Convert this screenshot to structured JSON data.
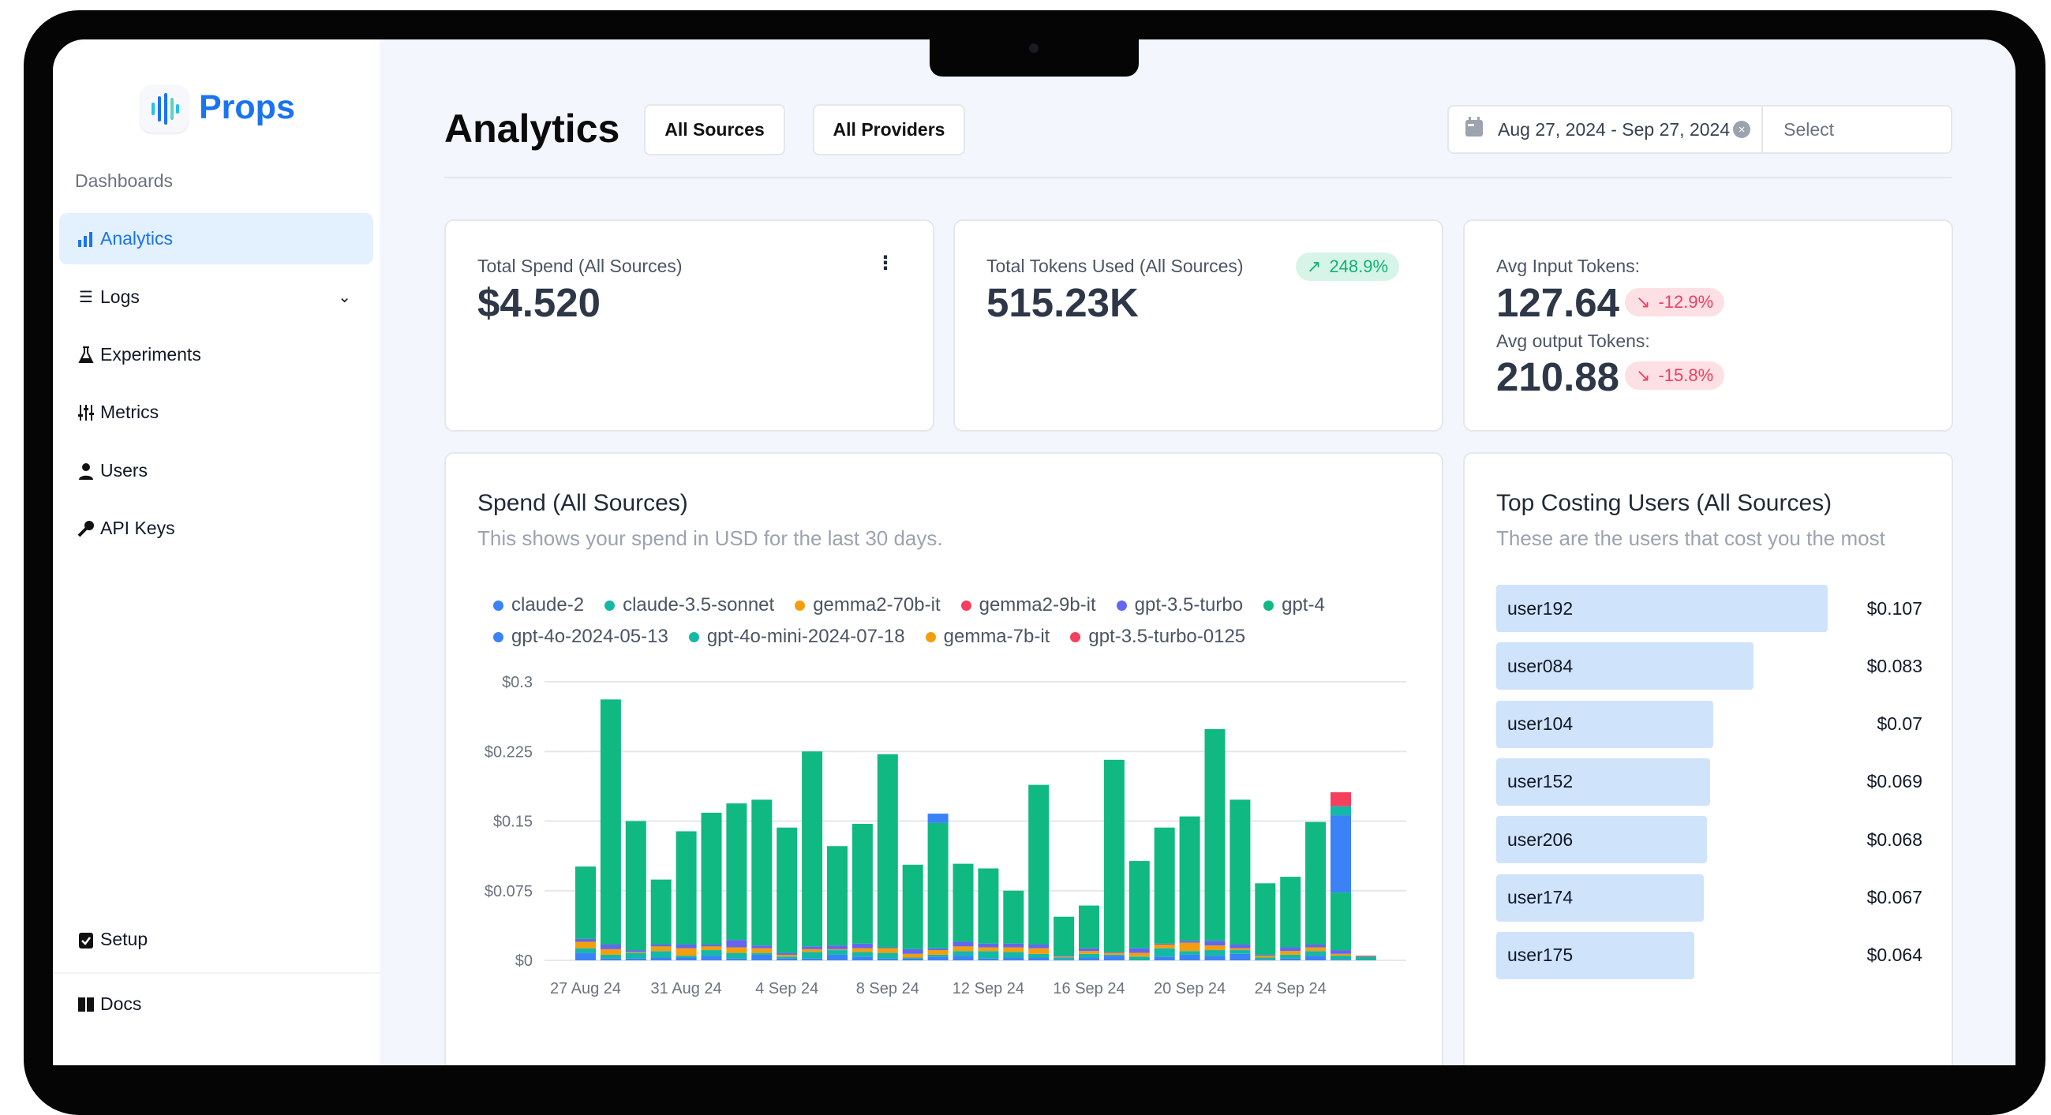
{
  "brand": {
    "name": "Props",
    "color": "#1a73f0"
  },
  "sidebar": {
    "section": "Dashboards",
    "items": [
      {
        "label": "Analytics",
        "icon": "bar-chart-icon",
        "active": true
      },
      {
        "label": "Logs",
        "icon": "list-icon",
        "expandable": true
      },
      {
        "label": "Experiments",
        "icon": "flask-icon"
      },
      {
        "label": "Metrics",
        "icon": "sliders-icon"
      },
      {
        "label": "Users",
        "icon": "user-icon"
      },
      {
        "label": "API Keys",
        "icon": "key-icon"
      }
    ],
    "bottom": [
      {
        "label": "Setup",
        "icon": "clipboard-check-icon"
      },
      {
        "label": "Docs",
        "icon": "book-icon"
      }
    ]
  },
  "header": {
    "title": "Analytics",
    "filters": [
      "All Sources",
      "All Providers"
    ],
    "date_range": "Aug 27, 2024 - Sep 27, 2024",
    "select_placeholder": "Select"
  },
  "stats": {
    "total_spend": {
      "label": "Total Spend (All Sources)",
      "value": "$4.520"
    },
    "total_tokens": {
      "label": "Total Tokens Used (All Sources)",
      "value": "515.23K",
      "change": "248.9%",
      "trend": "up"
    },
    "avg_input": {
      "label": "Avg Input Tokens:",
      "value": "127.64",
      "change": "-12.9%",
      "trend": "down"
    },
    "avg_output": {
      "label": "Avg output Tokens:",
      "value": "210.88",
      "change": "-15.8%",
      "trend": "down"
    }
  },
  "spend_card": {
    "title": "Spend (All Sources)",
    "subtitle": "This shows your spend in USD for the last 30 days."
  },
  "chart_data": {
    "type": "bar",
    "stacked": true,
    "ylim": [
      0,
      0.3
    ],
    "grid": true,
    "legend": "top",
    "yticks": [
      "$0",
      "$0.075",
      "$0.15",
      "$0.225",
      "$0.3"
    ],
    "ytick_values": [
      0,
      0.075,
      0.15,
      0.225,
      0.3
    ],
    "categories": [
      "27 Aug 24",
      "28 Aug 24",
      "29 Aug 24",
      "30 Aug 24",
      "31 Aug 24",
      "1 Sep 24",
      "2 Sep 24",
      "3 Sep 24",
      "4 Sep 24",
      "5 Sep 24",
      "6 Sep 24",
      "7 Sep 24",
      "8 Sep 24",
      "9 Sep 24",
      "10 Sep 24",
      "11 Sep 24",
      "12 Sep 24",
      "13 Sep 24",
      "14 Sep 24",
      "15 Sep 24",
      "16 Sep 24",
      "17 Sep 24",
      "18 Sep 24",
      "19 Sep 24",
      "20 Sep 24",
      "21 Sep 24",
      "22 Sep 24",
      "23 Sep 24",
      "24 Sep 24",
      "25 Sep 24",
      "26 Sep 24",
      "27 Sep 24"
    ],
    "xtick_labels": [
      "27 Aug 24",
      "31 Aug 24",
      "4 Sep 24",
      "8 Sep 24",
      "12 Sep 24",
      "16 Sep 24",
      "20 Sep 24",
      "24 Sep 24"
    ],
    "series": [
      {
        "name": "claude-2",
        "color": "#3b82f6",
        "values": [
          0.008,
          0.002,
          0.002,
          0.003,
          0.003,
          0.005,
          0.002,
          0.006,
          0.002,
          0.002,
          0.006,
          0.004,
          0.002,
          0.002,
          0.004,
          0.005,
          0.002,
          0.003,
          0.003,
          0.001,
          0.003,
          0.005,
          0,
          0.004,
          0.006,
          0.005,
          0.007,
          0.001,
          0.002,
          0.005,
          0.001,
          0
        ]
      },
      {
        "name": "claude-3.5-sonnet",
        "color": "#14b8a6",
        "values": [
          0.005,
          0.004,
          0.006,
          0.007,
          0.002,
          0.006,
          0.006,
          0.002,
          0.002,
          0.007,
          0.005,
          0.005,
          0.006,
          0.001,
          0.002,
          0.005,
          0.008,
          0.006,
          0.004,
          0.002,
          0.004,
          0.001,
          0.004,
          0.009,
          0.004,
          0.006,
          0.004,
          0.002,
          0.004,
          0.005,
          0.004,
          0.004
        ]
      },
      {
        "name": "gemma2-70b-it",
        "color": "#f59e0b",
        "values": [
          0.007,
          0.006,
          0.001,
          0.005,
          0.008,
          0.004,
          0.006,
          0.005,
          0.002,
          0.003,
          0.001,
          0.004,
          0.005,
          0.004,
          0.005,
          0.005,
          0.004,
          0.005,
          0.006,
          0.001,
          0.003,
          0.002,
          0.004,
          0.004,
          0.009,
          0.005,
          0.002,
          0.002,
          0.004,
          0.004,
          0.002,
          0
        ]
      },
      {
        "name": "gemma2-9b-it",
        "color": "#f43f5e",
        "values": [
          0,
          0,
          0,
          0,
          0,
          0,
          0,
          0,
          0,
          0,
          0,
          0,
          0,
          0,
          0,
          0,
          0,
          0,
          0,
          0,
          0,
          0,
          0,
          0,
          0,
          0,
          0,
          0,
          0,
          0,
          0,
          0
        ]
      },
      {
        "name": "gpt-3.5-turbo",
        "color": "#6366f1",
        "values": [
          0.003,
          0.005,
          0.002,
          0.002,
          0.004,
          0.002,
          0.008,
          0.003,
          0.002,
          0.003,
          0.004,
          0.005,
          0.001,
          0.005,
          0.002,
          0.005,
          0.004,
          0.004,
          0.004,
          0.001,
          0.003,
          0.001,
          0.005,
          0.001,
          0.002,
          0.005,
          0.004,
          0.001,
          0.004,
          0.003,
          0.004,
          0
        ]
      },
      {
        "name": "gpt-4",
        "color": "#10b981",
        "values": [
          0.078,
          0.264,
          0.139,
          0.07,
          0.122,
          0.142,
          0.147,
          0.157,
          0.135,
          0.21,
          0.107,
          0.129,
          0.208,
          0.091,
          0.135,
          0.084,
          0.081,
          0.057,
          0.172,
          0.042,
          0.046,
          0.207,
          0.094,
          0.125,
          0.134,
          0.228,
          0.156,
          0.077,
          0.076,
          0.132,
          0.062,
          0
        ]
      },
      {
        "name": "gpt-4o-2024-05-13",
        "color": "#3b82f6",
        "values": [
          0,
          0,
          0,
          0,
          0,
          0,
          0,
          0,
          0,
          0,
          0,
          0,
          0,
          0,
          0.01,
          0,
          0,
          0,
          0,
          0,
          0,
          0,
          0,
          0,
          0,
          0,
          0,
          0,
          0,
          0,
          0.083,
          0
        ]
      },
      {
        "name": "gpt-4o-mini-2024-07-18",
        "color": "#14b8a6",
        "values": [
          0,
          0,
          0,
          0,
          0,
          0,
          0,
          0,
          0,
          0,
          0,
          0,
          0,
          0,
          0,
          0,
          0,
          0,
          0,
          0,
          0,
          0,
          0,
          0,
          0,
          0,
          0,
          0,
          0,
          0,
          0.01,
          0
        ]
      },
      {
        "name": "gemma-7b-it",
        "color": "#f59e0b",
        "values": [
          0,
          0,
          0,
          0,
          0,
          0,
          0,
          0,
          0,
          0,
          0,
          0,
          0,
          0,
          0,
          0,
          0,
          0,
          0,
          0,
          0,
          0,
          0,
          0,
          0,
          0,
          0,
          0,
          0,
          0,
          0,
          0
        ]
      },
      {
        "name": "gpt-3.5-turbo-0125",
        "color": "#f43f5e",
        "values": [
          0,
          0,
          0,
          0,
          0,
          0,
          0,
          0,
          0,
          0,
          0,
          0,
          0,
          0,
          0,
          0,
          0,
          0,
          0,
          0,
          0,
          0,
          0,
          0,
          0,
          0,
          0,
          0,
          0,
          0,
          0.015,
          0.001
        ]
      }
    ]
  },
  "top_users": {
    "title": "Top Costing Users (All Sources)",
    "subtitle": "These are the users that cost you the most",
    "users": [
      {
        "name": "user192",
        "cost": "$0.107",
        "value": 0.107
      },
      {
        "name": "user084",
        "cost": "$0.083",
        "value": 0.083
      },
      {
        "name": "user104",
        "cost": "$0.07",
        "value": 0.07
      },
      {
        "name": "user152",
        "cost": "$0.069",
        "value": 0.069
      },
      {
        "name": "user206",
        "cost": "$0.068",
        "value": 0.068
      },
      {
        "name": "user174",
        "cost": "$0.067",
        "value": 0.067
      },
      {
        "name": "user175",
        "cost": "$0.064",
        "value": 0.064
      }
    ]
  }
}
